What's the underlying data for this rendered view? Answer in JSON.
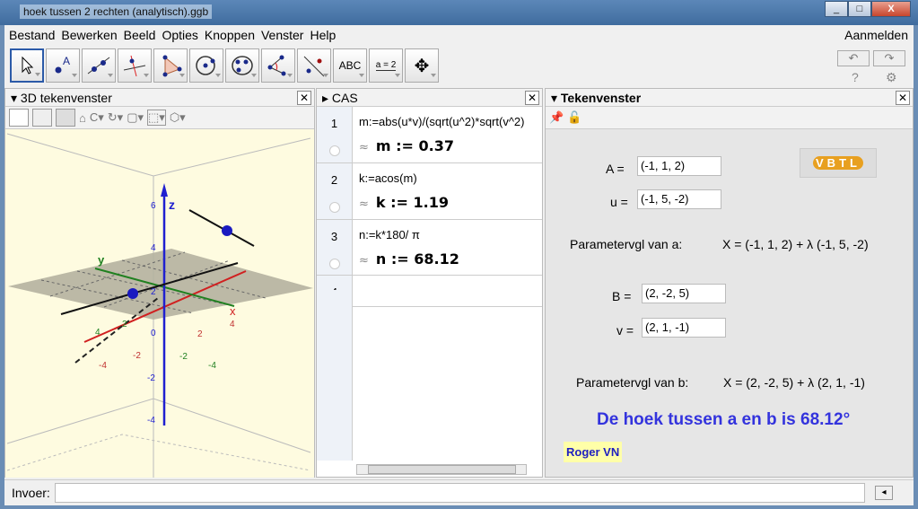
{
  "window": {
    "title": "hoek tussen 2 rechten (analytisch).ggb",
    "buttons": [
      "_",
      "□",
      "X"
    ]
  },
  "menu": {
    "items": [
      "Bestand",
      "Bewerken",
      "Beeld",
      "Opties",
      "Knoppen",
      "Venster",
      "Help"
    ],
    "login": "Aanmelden"
  },
  "toolbar": {
    "tools": [
      "move",
      "point",
      "line",
      "perpendicular",
      "polygon",
      "circle",
      "conic",
      "angle",
      "reflect",
      "text",
      "slider",
      "move-graphics-view"
    ],
    "text_label": "ABC",
    "slider_label": "a = 2",
    "undo": "↶",
    "redo": "↷",
    "help": "?",
    "settings": "⚙"
  },
  "view3d": {
    "title": "3D tekenvenster",
    "axes": {
      "x": "x",
      "y": "y",
      "z": "z"
    },
    "z_ticks": [
      "6",
      "4",
      "2",
      "0",
      "-2",
      "-4"
    ],
    "x_ticks": [
      "-4",
      "-2",
      "2",
      "4"
    ],
    "y_ticks": [
      "-4",
      "-2",
      "2",
      "4"
    ],
    "colors": {
      "x": "#d02020",
      "y": "#208020",
      "z": "#2020d0",
      "background": "#fefbe0"
    }
  },
  "cas": {
    "title": "CAS",
    "rows": [
      {
        "num": "1",
        "input": "m:=abs(u*v)/(sqrt(u^2)*sqrt(v^2)",
        "approx": "≈",
        "output": "m := 0.37"
      },
      {
        "num": "2",
        "input": "k:=acos(m)",
        "approx": "≈",
        "output": "k := 1.19"
      },
      {
        "num": "3",
        "input": "n:=k*180/ π",
        "approx": "≈",
        "output": "n := 68.12"
      },
      {
        "num": "4",
        "input": "",
        "approx": "",
        "output": ""
      }
    ]
  },
  "graphics": {
    "title": "Tekenvenster",
    "A_label": "A =",
    "A_value": "(-1, 1, 2)",
    "u_label": "u =",
    "u_value": "(-1, 5, -2)",
    "eq_a_label": "Parametervgl van a:",
    "eq_a": "X = (-1, 1, 2) + λ (-1, 5, -2)",
    "B_label": "B =",
    "B_value": "(2, -2, 5)",
    "v_label": "v =",
    "v_value": "(2, 1, -1)",
    "eq_b_label": "Parametervgl van b:",
    "eq_b": "X = (2, -2, 5) + λ (2, 1, -1)",
    "result": "De hoek tussen a en b is  68.12°",
    "author": "Roger VN",
    "logo": "VBTL"
  },
  "input": {
    "label": "Invoer:",
    "value": ""
  }
}
